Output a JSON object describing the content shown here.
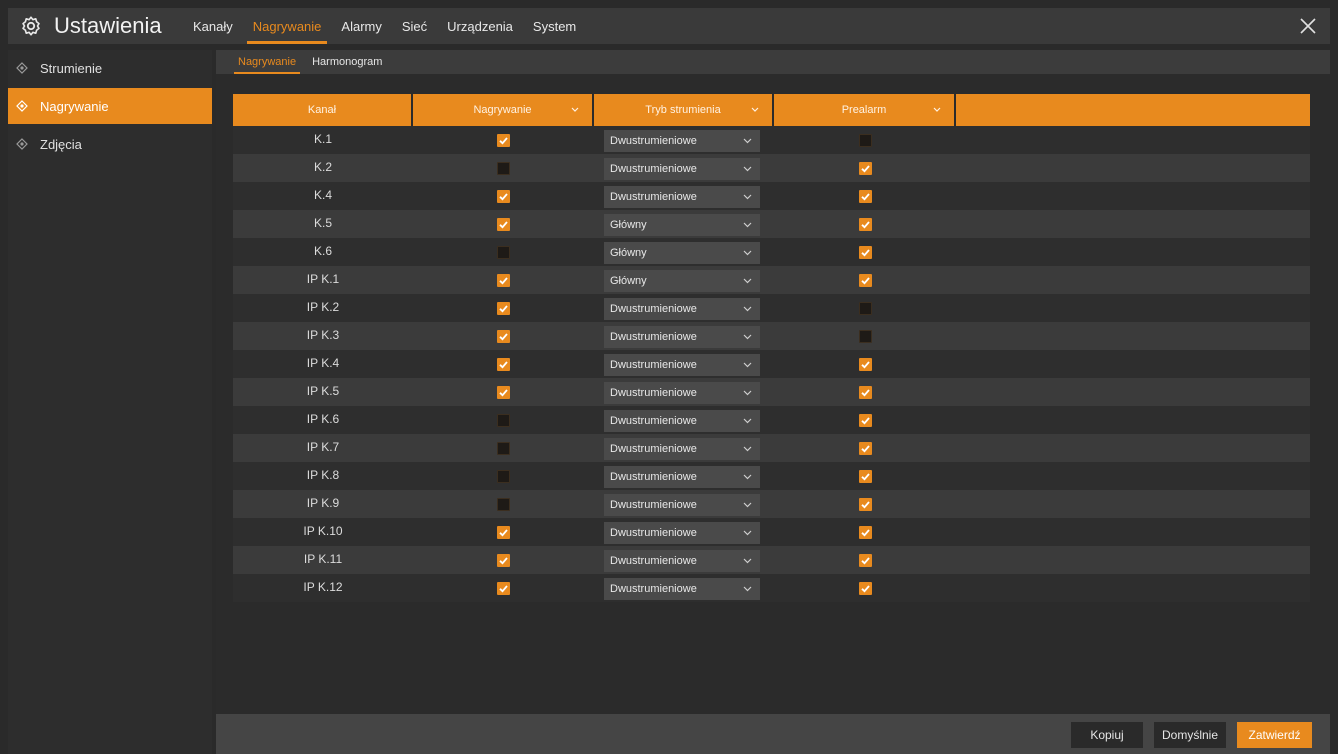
{
  "app": {
    "title": "Ustawienia"
  },
  "topnav": [
    "Kanały",
    "Nagrywanie",
    "Alarmy",
    "Sieć",
    "Urządzenia",
    "System"
  ],
  "topnav_active": "Nagrywanie",
  "sidebar": {
    "items": [
      {
        "label": "Strumienie",
        "active": false
      },
      {
        "label": "Nagrywanie",
        "active": true
      },
      {
        "label": "Zdjęcia",
        "active": false
      }
    ]
  },
  "subtabs": [
    "Nagrywanie",
    "Harmonogram"
  ],
  "table": {
    "headers": {
      "channel": "Kanał",
      "recording": "Nagrywanie",
      "stream_mode": "Tryb strumienia",
      "prealarm": "Prealarm"
    },
    "rows": [
      {
        "channel": "K.1",
        "recording": true,
        "mode": "Dwustrumieniowe",
        "prealarm": false
      },
      {
        "channel": "K.2",
        "recording": false,
        "mode": "Dwustrumieniowe",
        "prealarm": true
      },
      {
        "channel": "K.4",
        "recording": true,
        "mode": "Dwustrumieniowe",
        "prealarm": true
      },
      {
        "channel": "K.5",
        "recording": true,
        "mode": "Główny",
        "prealarm": true
      },
      {
        "channel": "K.6",
        "recording": false,
        "mode": "Główny",
        "prealarm": true
      },
      {
        "channel": "IP K.1",
        "recording": true,
        "mode": "Główny",
        "prealarm": true
      },
      {
        "channel": "IP K.2",
        "recording": true,
        "mode": "Dwustrumieniowe",
        "prealarm": false
      },
      {
        "channel": "IP K.3",
        "recording": true,
        "mode": "Dwustrumieniowe",
        "prealarm": false
      },
      {
        "channel": "IP K.4",
        "recording": true,
        "mode": "Dwustrumieniowe",
        "prealarm": true
      },
      {
        "channel": "IP K.5",
        "recording": true,
        "mode": "Dwustrumieniowe",
        "prealarm": true
      },
      {
        "channel": "IP K.6",
        "recording": false,
        "mode": "Dwustrumieniowe",
        "prealarm": true
      },
      {
        "channel": "IP K.7",
        "recording": false,
        "mode": "Dwustrumieniowe",
        "prealarm": true
      },
      {
        "channel": "IP K.8",
        "recording": false,
        "mode": "Dwustrumieniowe",
        "prealarm": true
      },
      {
        "channel": "IP K.9",
        "recording": false,
        "mode": "Dwustrumieniowe",
        "prealarm": true
      },
      {
        "channel": "IP K.10",
        "recording": true,
        "mode": "Dwustrumieniowe",
        "prealarm": true
      },
      {
        "channel": "IP K.11",
        "recording": true,
        "mode": "Dwustrumieniowe",
        "prealarm": true
      },
      {
        "channel": "IP K.12",
        "recording": true,
        "mode": "Dwustrumieniowe",
        "prealarm": true
      }
    ]
  },
  "buttons": {
    "copy": "Kopiuj",
    "default": "Domyślnie",
    "apply": "Zatwierdź"
  },
  "colors": {
    "accent": "#e88a1e",
    "background": "#2a2a2a"
  },
  "icons": {
    "settings": "gear-icon",
    "close": "close-icon",
    "sidebar_bullet": "diamond-icon",
    "dropdown": "chevron-down-icon"
  }
}
